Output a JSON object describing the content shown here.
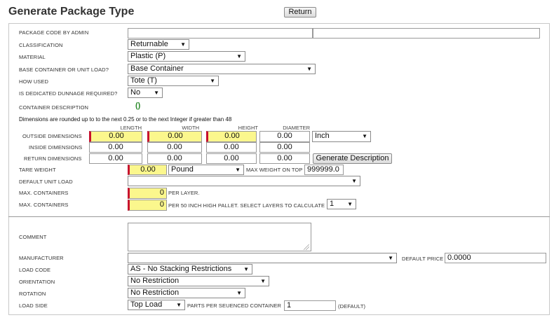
{
  "title": "Generate Package Type",
  "return_label": "Return",
  "labels": {
    "package_code": "PACKAGE CODE BY ADMIN",
    "classification": "CLASSIFICATION",
    "material": "MATERIAL",
    "base_container": "BASE CONTAINER OR UNIT LOAD?",
    "how_used": "HOW USED",
    "dunnage": "IS DEDICATED DUNNAGE REQUIRED?",
    "container_description": "CONTAINER DESCRIPTION",
    "outside_dimensions": "OUTSIDE DIMENSIONS",
    "inside_dimensions": "INSIDE DIMENSIONS",
    "return_dimensions": "RETURN DIMENSIONS",
    "tare_weight": "TARE WEIGHT",
    "max_weight_on_top": "MAX WEIGHT ON TOP",
    "default_unit_load": "DEFAULT UNIT LOAD",
    "max_containers_1": "MAX. CONTAINERS",
    "max_containers_2": "MAX. CONTAINERS",
    "per_layer": "PER LAYER.",
    "per_pallet": "PER 50 INCH HIGH PALLET. SELECT LAYERS TO CALCULATE",
    "comment": "COMMENT",
    "manufacturer": "MANUFACTURER",
    "default_price": "DEFAULT PRICE",
    "load_code": "LOAD CODE",
    "orientation": "ORIENTATION",
    "rotation": "ROTATION",
    "load_side": "LOAD SIDE",
    "parts_per_sequenced": "PARTS PER SEUENCED CONTAINER",
    "default_suffix": "(DEFAULT)"
  },
  "note": "Dimensions are rounded up to to the next 0.25 or to the next Integer if greater than 48",
  "column_headers": {
    "length": "LENGTH",
    "width": "WIDTH",
    "height": "HEIGHT",
    "diameter": "DIAMETER"
  },
  "container_description_value": "()",
  "values": {
    "package_code_a": "",
    "package_code_b": "",
    "classification": "Returnable",
    "material": "Plastic (P)",
    "base_container": "Base Container",
    "how_used": "Tote (T)",
    "dunnage": "No",
    "unit": "Inch",
    "outside": {
      "length": "0.00",
      "width": "0.00",
      "height": "0.00",
      "diameter": "0.00"
    },
    "inside": {
      "length": "0.00",
      "width": "0.00",
      "height": "0.00",
      "diameter": "0.00"
    },
    "return": {
      "length": "0.00",
      "width": "0.00",
      "height": "0.00",
      "diameter": "0.00"
    },
    "tare_weight": "0.00",
    "weight_unit": "Pound",
    "max_weight_on_top": "999999.0",
    "default_unit_load": "",
    "max_containers_layer": "0",
    "max_containers_pallet": "0",
    "layers": "1",
    "comment": "",
    "manufacturer": "",
    "default_price": "0.0000",
    "load_code": "AS - No Stacking Restrictions",
    "orientation": "No Restriction",
    "rotation": "No Restriction",
    "load_side": "Top Load",
    "parts_per_sequenced": "1"
  },
  "generate_description_label": "Generate Description",
  "arrow_glyph": "▼"
}
